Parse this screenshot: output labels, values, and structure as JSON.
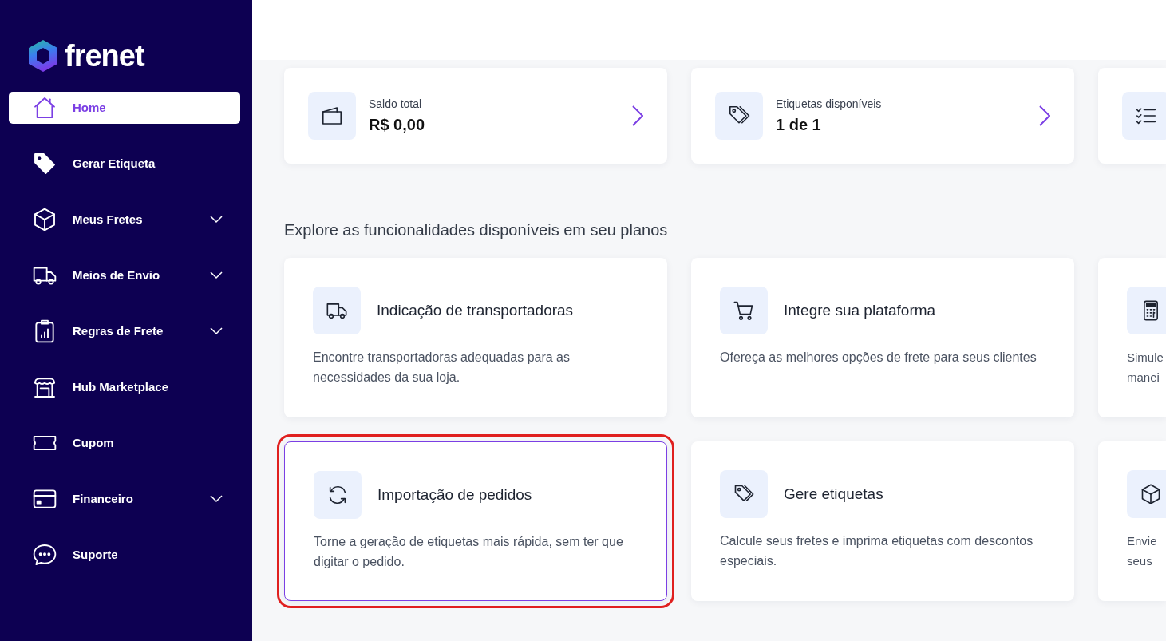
{
  "logo": {
    "text": "frenet"
  },
  "sidebar": {
    "items": [
      {
        "label": "Home",
        "selected": true,
        "expandable": false
      },
      {
        "label": "Gerar Etiqueta",
        "selected": false,
        "expandable": false
      },
      {
        "label": "Meus Fretes",
        "selected": false,
        "expandable": true
      },
      {
        "label": "Meios de Envio",
        "selected": false,
        "expandable": true
      },
      {
        "label": "Regras de Frete",
        "selected": false,
        "expandable": true
      },
      {
        "label": "Hub Marketplace",
        "selected": false,
        "expandable": false
      },
      {
        "label": "Cupom",
        "selected": false,
        "expandable": false
      },
      {
        "label": "Financeiro",
        "selected": false,
        "expandable": true
      },
      {
        "label": "Suporte",
        "selected": false,
        "expandable": false
      }
    ]
  },
  "summary_cards": [
    {
      "kind": "full",
      "label": "Saldo total",
      "value": "R$ 0,00"
    },
    {
      "kind": "full",
      "label": "Etiquetas disponíveis",
      "value": "1 de 1"
    },
    {
      "kind": "partial"
    }
  ],
  "section_title": "Explore as funcionalidades disponíveis em seu planos",
  "features": [
    {
      "title": "Indicação de transportadoras",
      "description": "Encontre transportadoras adequadas para as necessidades da sua loja.",
      "highlighted": false
    },
    {
      "title": "Integre sua plataforma",
      "description": "Ofereça as melhores opções de frete para seus clientes",
      "highlighted": false
    },
    {
      "description": "Simule manei",
      "highlighted": false
    },
    {
      "title": "Importação de pedidos",
      "description": "Torne a geração de etiquetas mais rápida, sem ter que digitar o pedido.",
      "highlighted": true
    },
    {
      "title": "Gere etiquetas",
      "description": "Calcule seus fretes e imprima etiquetas com descontos especiais.",
      "highlighted": false
    },
    {
      "description": "Envie seus",
      "highlighted": false
    }
  ]
}
